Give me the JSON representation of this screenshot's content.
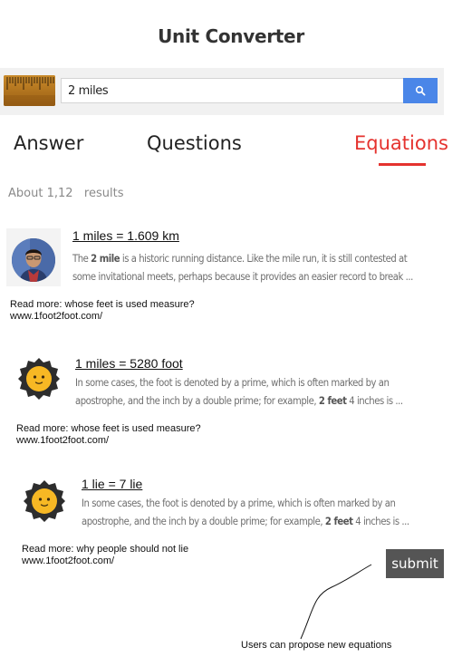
{
  "app": {
    "title": "Unit Converter"
  },
  "search": {
    "value": "2 miles",
    "button_icon": "search-icon"
  },
  "tabs": [
    {
      "label": "Answer",
      "active": false
    },
    {
      "label": "Questions",
      "active": false
    },
    {
      "label": "Equations",
      "active": true
    }
  ],
  "colors": {
    "accent": "#e5322e",
    "search_button": "#4a86e8",
    "submit_button": "#555555"
  },
  "results_count": "About 1,12   results",
  "results": [
    {
      "avatar": "user-photo",
      "title": "1 miles = 1.609 km",
      "snippet": {
        "pre": "The ",
        "bold": "2 mile",
        "post": " is a historic running distance. Like the mile run, it is still contested at some invitational meets, perhaps because it provides an easier record to break ..."
      },
      "readmore": "Read more: whose feet is used measure?",
      "link": "www.1foot2foot.com/"
    },
    {
      "avatar": "sun-icon",
      "title": "1 miles = 5280 foot",
      "snippet": {
        "pre": "In some cases, the foot is denoted by a prime, which is often marked by an apostrophe, and the inch by a double prime; for example, ",
        "bold": "2 feet",
        "post": " 4 inches is ..."
      },
      "readmore": "Read more: whose feet is used measure?",
      "link": "www.1foot2foot.com/"
    },
    {
      "avatar": "sun-icon",
      "title": "1 lie = 7 lie",
      "snippet": {
        "pre": "In some cases, the foot is denoted by a prime, which is often marked by an apostrophe, and the inch by a double prime; for example, ",
        "bold": "2 feet",
        "post": " 4 inches is ..."
      },
      "readmore": "Read more: why people should not lie",
      "link": "www.1foot2foot.com/"
    }
  ],
  "submit": {
    "label": "submit"
  },
  "annotation": {
    "text": "Users can propose new equations"
  }
}
